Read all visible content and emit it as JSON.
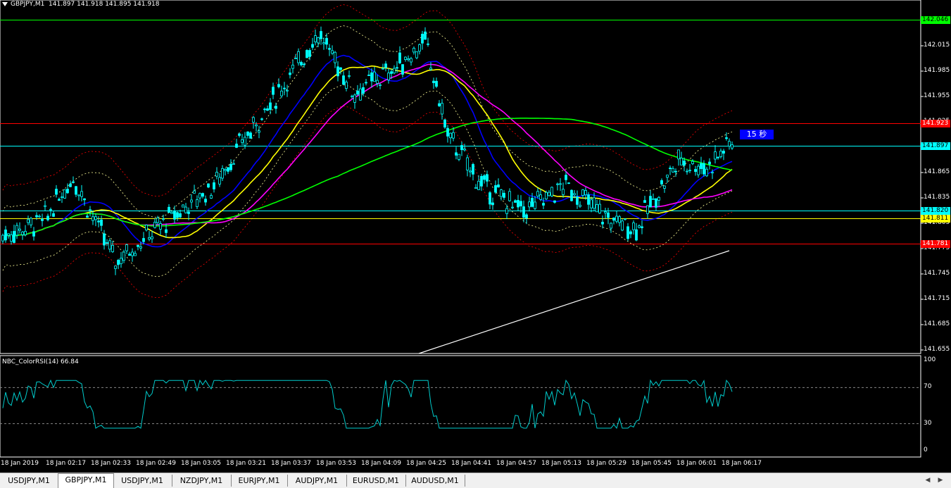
{
  "chart": {
    "symbol_label": "GBPJPY,M1",
    "ohlc_text": "141.897 141.918 141.895 141.918",
    "timer_label": "15 秒",
    "price_ticks": [
      "142.015",
      "141.985",
      "141.955",
      "141.925",
      "141.865",
      "141.835",
      "141.805",
      "141.775",
      "141.745",
      "141.715",
      "141.685",
      "141.655"
    ],
    "price_lines": [
      {
        "label": "142.046",
        "color": "#00ff00",
        "text_color": "#000"
      },
      {
        "label": "141.923",
        "color": "#ff0000",
        "text_color": "#fff"
      },
      {
        "label": "141.897",
        "color": "#00ffff",
        "text_color": "#000"
      },
      {
        "label": "141.820",
        "color": "#00ffff",
        "text_color": "#000"
      },
      {
        "label": "141.811",
        "color": "#ffff00",
        "text_color": "#000"
      },
      {
        "label": "141.781",
        "color": "#ff0000",
        "text_color": "#fff"
      }
    ],
    "time_labels": [
      "18 Jan 2019",
      "18 Jan 02:17",
      "18 Jan 02:33",
      "18 Jan 02:49",
      "18 Jan 03:05",
      "18 Jan 03:21",
      "18 Jan 03:37",
      "18 Jan 03:53",
      "18 Jan 04:09",
      "18 Jan 04:25",
      "18 Jan 04:41",
      "18 Jan 04:57",
      "18 Jan 05:13",
      "18 Jan 05:29",
      "18 Jan 05:45",
      "18 Jan 06:01",
      "18 Jan 06:17"
    ]
  },
  "indicator": {
    "label": "NBC_ColorRSI(14) 66.84",
    "ticks": [
      "100",
      "70",
      "30",
      "0"
    ]
  },
  "tabs": [
    {
      "label": "USDJPY,M1",
      "active": false
    },
    {
      "label": "GBPJPY,M1",
      "active": true
    },
    {
      "label": "USDJPY,M1",
      "active": false
    },
    {
      "label": "NZDJPY,M1",
      "active": false
    },
    {
      "label": "EURJPY,M1",
      "active": false
    },
    {
      "label": "AUDJPY,M1",
      "active": false
    },
    {
      "label": "EURUSD,M1",
      "active": false
    },
    {
      "label": "AUDUSD,M1",
      "active": false
    }
  ],
  "colors": {
    "candle": "#00ffff",
    "ma_yellow": "#ffff00",
    "ma_magenta": "#ff00ff",
    "ma_blue": "#0000ff",
    "ma_green": "#00ff00",
    "ma_white": "#ffffff",
    "rsi": "#00cccc",
    "bands": "#ff0000",
    "bands_inner": "#ffff99"
  },
  "icons": {
    "scroll_left": "triangle-left-icon",
    "scroll_right": "triangle-right-icon",
    "menu": "triangle-down-icon"
  }
}
